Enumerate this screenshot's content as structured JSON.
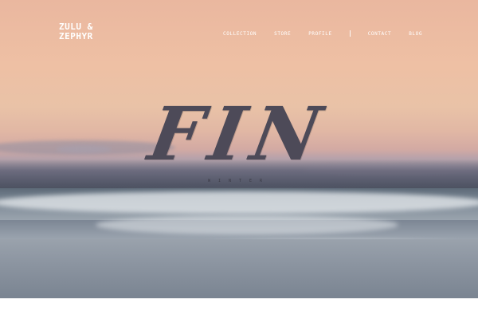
{
  "brand": {
    "line1": "ZULU &",
    "line2": "ZEPHYR"
  },
  "nav": {
    "items": [
      "COLLECTION",
      "STORE",
      "PROFILE",
      "CONTACT",
      "BLOG"
    ]
  },
  "hero": {
    "title": "FIN",
    "subtitle": "WINTER"
  }
}
